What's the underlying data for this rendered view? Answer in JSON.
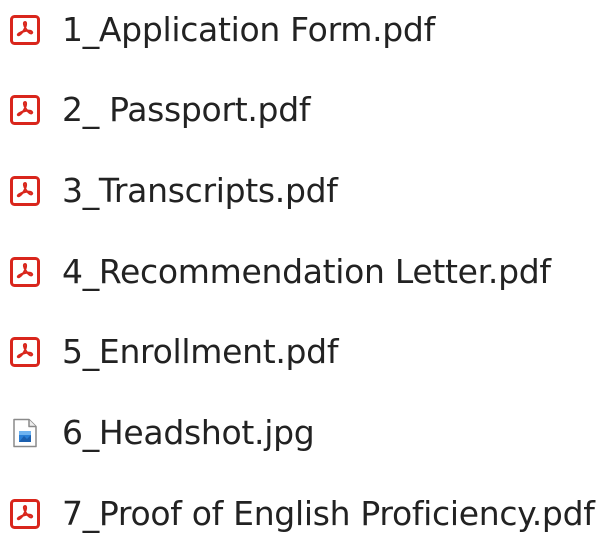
{
  "files": [
    {
      "name": "1_Application Form.pdf",
      "icon": "pdf-icon"
    },
    {
      "name": "2_ Passport.pdf",
      "icon": "pdf-icon"
    },
    {
      "name": "3_Transcripts.pdf",
      "icon": "pdf-icon"
    },
    {
      "name": "4_Recommendation Letter.pdf",
      "icon": "pdf-icon"
    },
    {
      "name": "5_Enrollment.pdf",
      "icon": "pdf-icon"
    },
    {
      "name": "6_Headshot.jpg",
      "icon": "image-file-icon"
    },
    {
      "name": "7_Proof of English Proficiency.pdf",
      "icon": "pdf-icon"
    }
  ],
  "colors": {
    "pdf_red": "#d9261c",
    "image_blue": "#2a7fd6",
    "text": "#222222"
  }
}
